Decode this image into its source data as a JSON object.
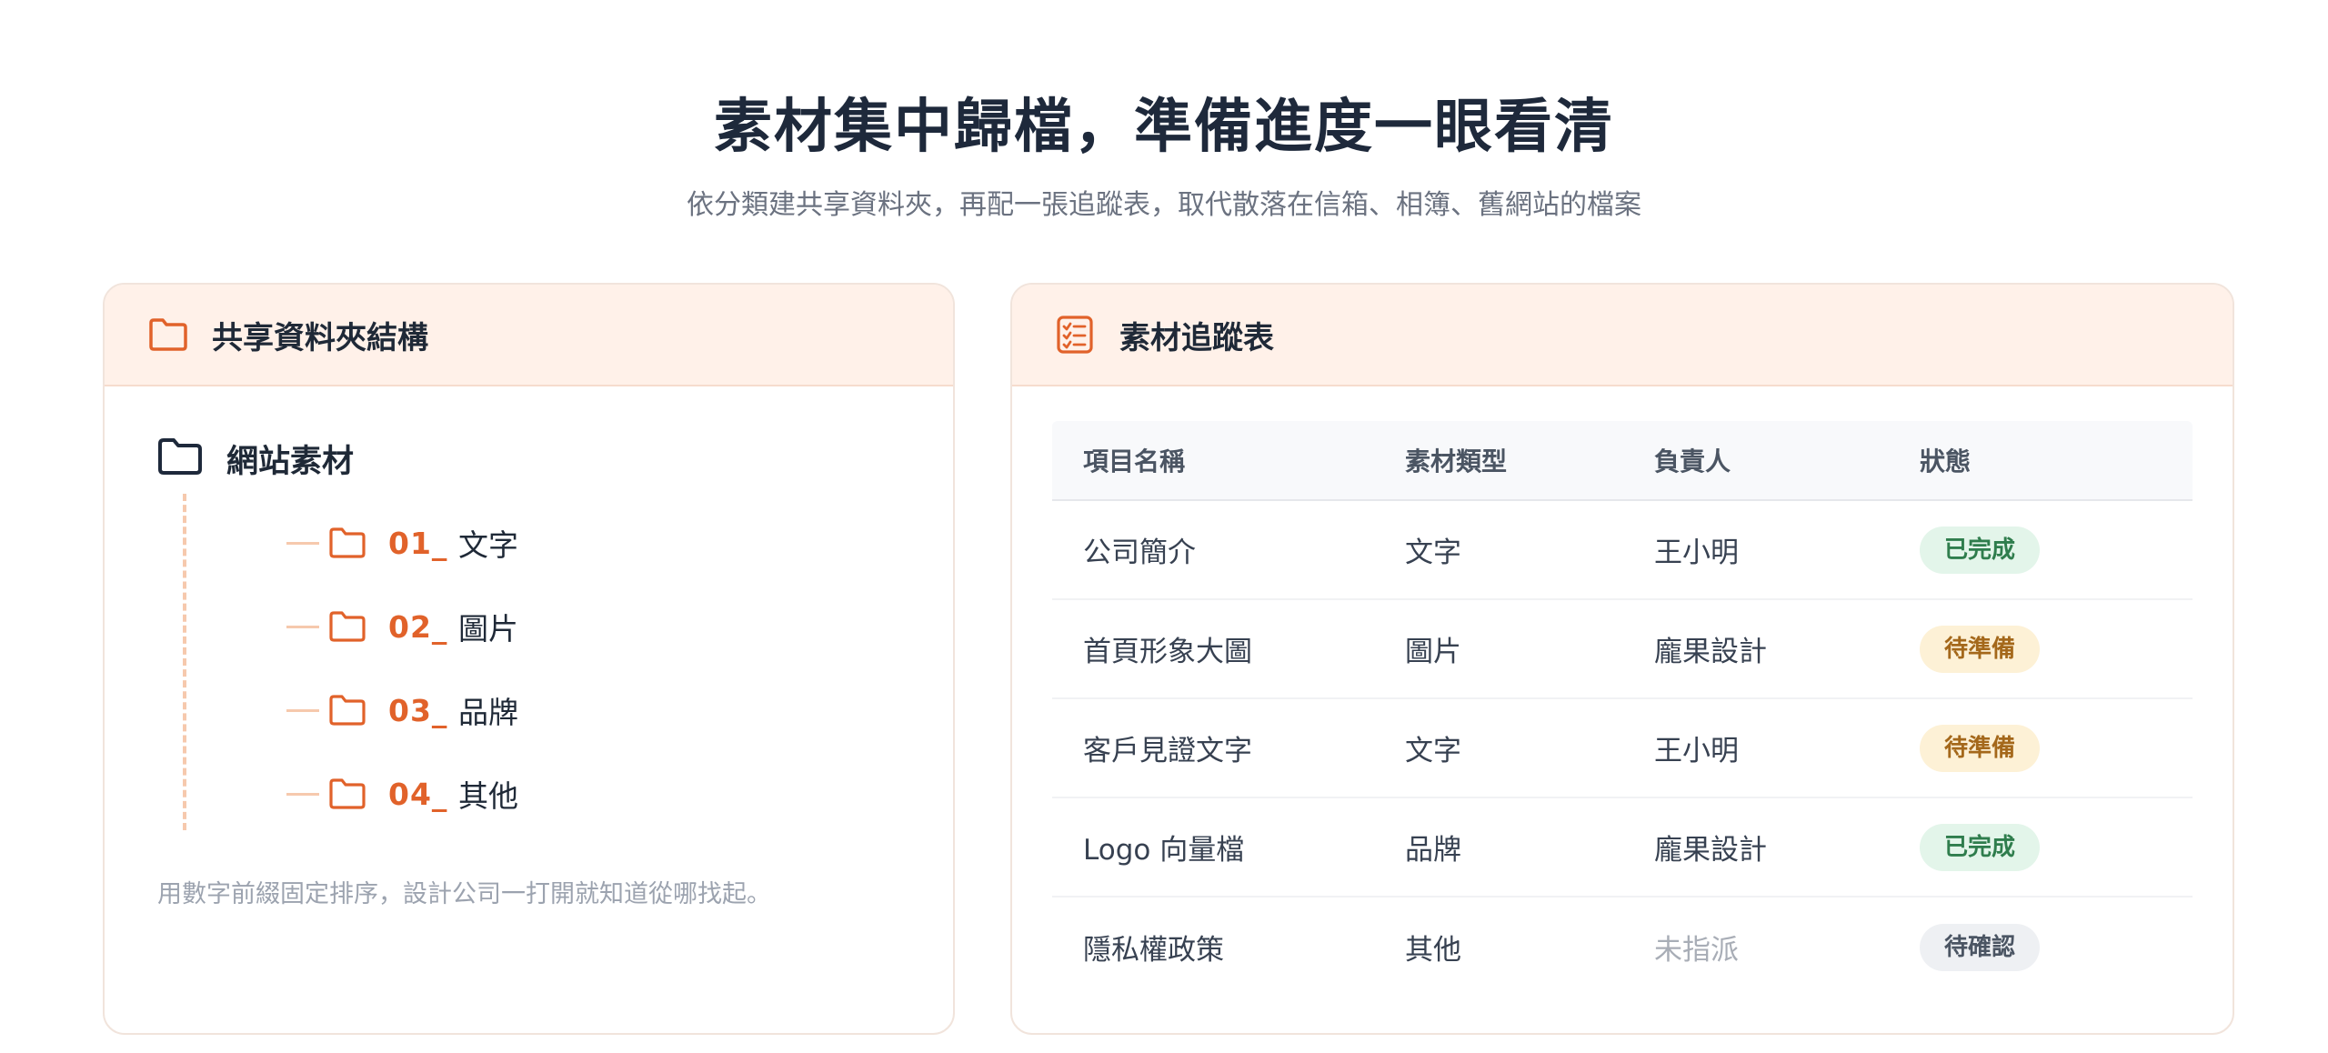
{
  "header": {
    "title": "素材集中歸檔，準備進度一眼看清",
    "subtitle": "依分類建共享資料夾，再配一張追蹤表，取代散落在信箱、相簿、舊網站的檔案"
  },
  "folder_card": {
    "title": "共享資料夾結構",
    "icon": "folder-icon",
    "root": "網站素材",
    "items": [
      {
        "num": "01_",
        "label": "文字"
      },
      {
        "num": "02_",
        "label": "圖片"
      },
      {
        "num": "03_",
        "label": "品牌"
      },
      {
        "num": "04_",
        "label": "其他"
      }
    ],
    "note": "用數字前綴固定排序，設計公司一打開就知道從哪找起。"
  },
  "tracker_card": {
    "title": "素材追蹤表",
    "icon": "checklist-icon",
    "columns": [
      "項目名稱",
      "素材類型",
      "負責人",
      "狀態"
    ],
    "rows": [
      {
        "name": "公司簡介",
        "type": "文字",
        "owner": "王小明",
        "status": "已完成"
      },
      {
        "name": "首頁形象大圖",
        "type": "圖片",
        "owner": "龐果設計",
        "status": "待準備"
      },
      {
        "name": "客戶見證文字",
        "type": "文字",
        "owner": "王小明",
        "status": "待準備"
      },
      {
        "name": "Logo 向量檔",
        "type": "品牌",
        "owner": "龐果設計",
        "status": "已完成"
      },
      {
        "name": "隱私權政策",
        "type": "其他",
        "owner": "未指派",
        "status": "待確認"
      }
    ]
  },
  "colors": {
    "accent": "#e1622a",
    "status_done": "#2f7d4d",
    "status_wait": "#a4681b",
    "status_confirm": "#4b5563"
  }
}
